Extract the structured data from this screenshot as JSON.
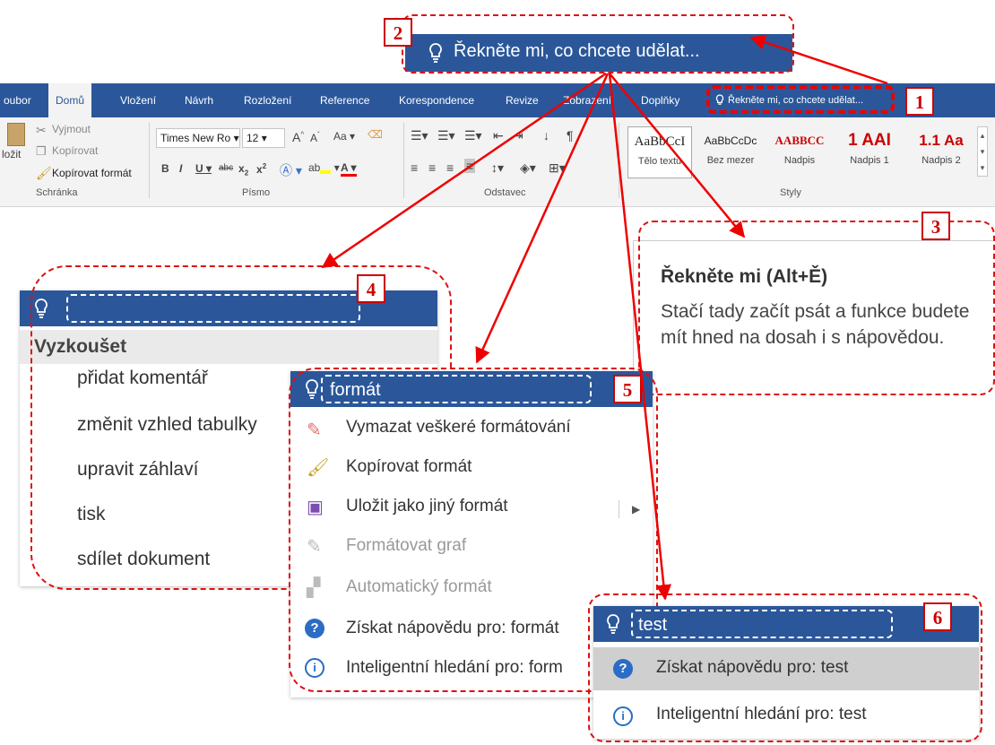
{
  "tellme_big": {
    "text": "Řekněte mi, co chcete udělat..."
  },
  "ribbon": {
    "tabs": [
      "oubor",
      "Domů",
      "Vložení",
      "Návrh",
      "Rozložení",
      "Reference",
      "Korespondence",
      "Revize",
      "Zobrazení",
      "Doplňky"
    ],
    "tellme_placeholder": "Řekněte mi, co chcete udělat...",
    "clipboard": {
      "cut": "Vyjmout",
      "copy": "Kopírovat",
      "format_painter": "Kopírovat formát",
      "paste": "ložit",
      "group": "Schránka"
    },
    "font": {
      "name": "Times New Ro",
      "size": "12",
      "group": "Písmo",
      "case": "Aa"
    },
    "paragraph": {
      "group": "Odstavec"
    },
    "styles": {
      "group": "Styly",
      "items": [
        {
          "sample": "AaBbCcI",
          "name": "Tělo textu"
        },
        {
          "sample": "AaBbCcDc",
          "name": "Bez mezer"
        },
        {
          "sample": "AABBCC",
          "name": "Nadpis"
        },
        {
          "sample": "1 AAI",
          "name": "Nadpis 1"
        },
        {
          "sample": "1.1 Aa",
          "name": "Nadpis 2"
        }
      ]
    }
  },
  "tooltip": {
    "title": "Řekněte mi (Alt+Ě)",
    "body": "Stačí tady začít psát a funkce budete mít hned na dosah i s nápovědou."
  },
  "panel4": {
    "heading": "Vyzkoušet",
    "items": [
      "přidat komentář",
      "změnit vzhled tabulky",
      "upravit záhlaví",
      "tisk",
      "sdílet dokument"
    ]
  },
  "panel5": {
    "query": "formát",
    "items": [
      {
        "label": "Vymazat veškeré formátování",
        "icon": "eraser-icon",
        "enabled": true
      },
      {
        "label": "Kopírovat formát",
        "icon": "format-painter-icon",
        "enabled": true
      },
      {
        "label": "Uložit jako jiný formát",
        "icon": "save-as-icon",
        "enabled": true
      },
      {
        "label": "Formátovat graf",
        "icon": "chart-format-icon",
        "enabled": false
      },
      {
        "label": "Automatický formát",
        "icon": "autoformat-icon",
        "enabled": false
      },
      {
        "label": "Získat nápovědu pro: formát",
        "icon": "help-icon",
        "enabled": true
      },
      {
        "label": "Inteligentní hledání pro: form",
        "icon": "smart-lookup-icon",
        "enabled": true
      }
    ]
  },
  "panel6": {
    "query": "test",
    "items": [
      {
        "label": "Získat nápovědu pro: test",
        "icon": "help-icon"
      },
      {
        "label": "Inteligentní hledání pro: test",
        "icon": "smart-lookup-icon"
      }
    ]
  },
  "callouts": [
    "1",
    "2",
    "3",
    "4",
    "5",
    "6"
  ],
  "colors": {
    "word_blue": "#2b579a",
    "callout_red": "#dd0000"
  }
}
